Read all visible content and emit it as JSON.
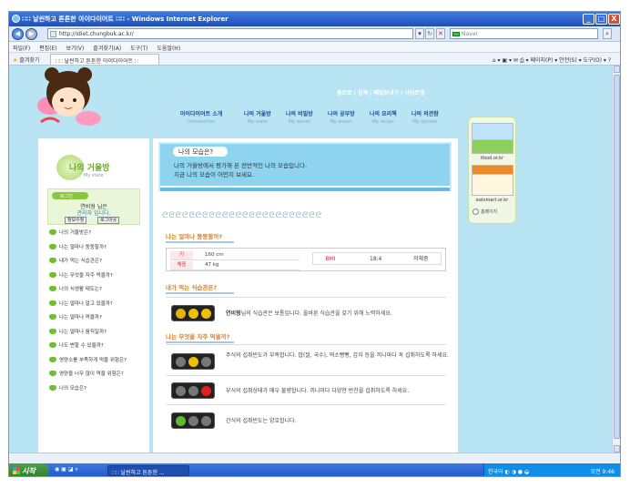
{
  "window": {
    "title": "∷∷ 날씬하고 튼튼한 아이다이어트 ∷∷ - Windows Internet Explorer",
    "minimize": "_",
    "maximize": "□",
    "close": "X"
  },
  "address": {
    "url": "http://idiet.chungbuk.ac.kr/",
    "search_placeholder": "Naver"
  },
  "menubar": [
    "파일(F)",
    "편집(E)",
    "보기(V)",
    "즐겨찾기(A)",
    "도구(T)",
    "도움말(H)"
  ],
  "favbar": {
    "favorites": "즐겨찾기",
    "tab": "∷∷ 날씬하고 튼튼한 아이다이어트 ∷",
    "tools": "페이지(P) ▾  안전(S) ▾  도구(O) ▾"
  },
  "site": {
    "top_links": "홈으로 | 검색 | 메일보내기 | 사이트맵",
    "nav": [
      {
        "ko": "아이다이어트 소개",
        "en": "Introduction"
      },
      {
        "ko": "나의 거울방",
        "en": "My state"
      },
      {
        "ko": "나의 비밀방",
        "en": "My secret"
      },
      {
        "ko": "나의 공부방",
        "en": "My lesson"
      },
      {
        "ko": "나의 요리책",
        "en": "My recipe"
      },
      {
        "ko": "나의 의견함",
        "en": "My opinion"
      }
    ]
  },
  "sidebar": {
    "title": "나의 거울방",
    "subtitle": "My state",
    "login_header": "로그인",
    "user_name": "연비형 님은",
    "user_level": "관리자 입니다.",
    "btn_info": "정보수정",
    "btn_logout": "로그아웃",
    "items": [
      "나의 거울방은?",
      "나는 얼마나 뚱뚱할까?",
      "내가 먹는 식습관은?",
      "나는 무엇을 자주 먹을까?",
      "나의 식생활 태도는?",
      "나는 얼마나 알고 있을까?",
      "나는 얼마나 먹을까?",
      "나는 얼마나 움직일까?",
      "나도 변할 수 있을까?",
      "영양소를 부족하게 먹을 위험은?",
      "영양을 너무 많이 먹을 위험은?",
      "나의 모습은?"
    ]
  },
  "main": {
    "intro_title": "나의 모습은?",
    "intro_line1": "나의 거울방에서 평가해 본 전반적인 나의 모습입니다.",
    "intro_line2": "지금 나의 모습이 어떤지 보세요.",
    "bubbles": "ᘓᘓᘓᘓᘓᘓᘓᘓᘓᘓᘓᘓᘓᘓᘓᘓᘓᘓᘓᘓᘓᘓᘓᘓ",
    "section1_title": "나는 얼마나 뚱뚱할까?",
    "height_label": "키",
    "height_value": "160 cm",
    "weight_label": "체중",
    "weight_value": "47 kg",
    "bmi_label": "BMI",
    "bmi_value": "18.4",
    "bmi_status": "저체중",
    "section2_title": "내가 먹는 식습관은?",
    "habit_text_name": "연비형",
    "habit_text": "님의 식습관은 보통입니다. 올바른 식습관을 갖기 위해 노력하세요.",
    "section3_title": "나는 무엇을 자주 먹을까?",
    "food1": "주식의 섭취빈도가 부족합니다. 밥(쌀, 국수), 떡소빵빵, 감자 등을 끼니마다 꼭 섭취하도록 하세요.",
    "food2": "부식의 섭취상태가 매우 불량합니다. 끼니마다 다양한 반찬을 섭취하도록 하세요.",
    "food3": "간식의 섭취빈도는 양호합니다."
  },
  "rightbar": {
    "banner1": "ifood.or.kr",
    "banner2": "eatsmart.or.kr",
    "homepage": "홈페이지"
  },
  "taskbar": {
    "start": "시작",
    "item": "∷∷ 날씬하고 튼튼한 ...",
    "tray_text": "한국어",
    "clock": "오전 9:46"
  },
  "colors": {
    "header_bg": "#b9e4f3",
    "accent_green": "#8cc63f",
    "section_title": "#e08020",
    "red": "#e02020",
    "yellow": "#f4c400",
    "green": "#5dbb2c"
  }
}
